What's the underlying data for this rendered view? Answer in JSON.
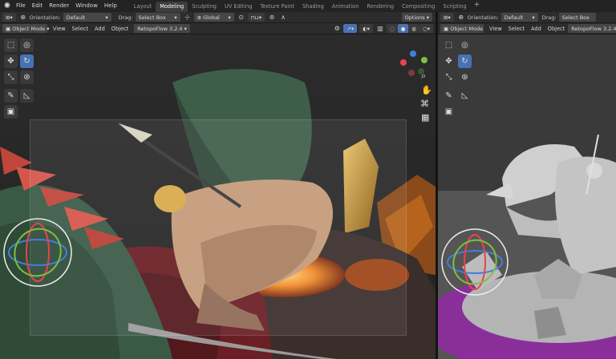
{
  "menubar": {
    "menus": [
      "File",
      "Edit",
      "Render",
      "Window",
      "Help"
    ],
    "workspace_tabs": [
      "Layout",
      "Modeling",
      "Sculpting",
      "UV Editing",
      "Texture Paint",
      "Shading",
      "Animation",
      "Rendering",
      "Compositing",
      "Scripting"
    ],
    "active_tab": "Modeling",
    "add_tab": "+"
  },
  "left_header": {
    "orientation_label": "Orientation:",
    "orientation_value": "Default",
    "drag_label": "Drag:",
    "drag_value": "Select Box",
    "transform_value": "Global",
    "options_label": "Options"
  },
  "left_subheader": {
    "mode": "Object Mode",
    "menus": [
      "View",
      "Select",
      "Add",
      "Object"
    ],
    "addon": "RetopoFlow 3.2.4"
  },
  "right_header": {
    "orientation_label": "Orientation:",
    "orientation_value": "Default",
    "drag_label": "Drag:",
    "drag_value": "Select Box"
  },
  "right_subheader": {
    "mode": "Object Mode",
    "menus": [
      "View",
      "Select",
      "Add",
      "Object"
    ],
    "addon": "RetopoFlow 3.2.4"
  },
  "colors": {
    "accent": "#4772b3",
    "background": "#1d1d1d",
    "header": "#2c2c2c",
    "gizmo_x": "#e8444f",
    "gizmo_y": "#7fbf3f",
    "gizmo_z": "#3f7fdf"
  },
  "icons": [
    "blender-logo",
    "select-box-icon",
    "cursor-icon",
    "move-icon",
    "rotate-icon",
    "scale-icon",
    "transform-icon",
    "annotate-icon",
    "measure-icon",
    "add-cube-icon",
    "zoom-icon",
    "hand-icon",
    "camera-icon",
    "grid-icon"
  ]
}
